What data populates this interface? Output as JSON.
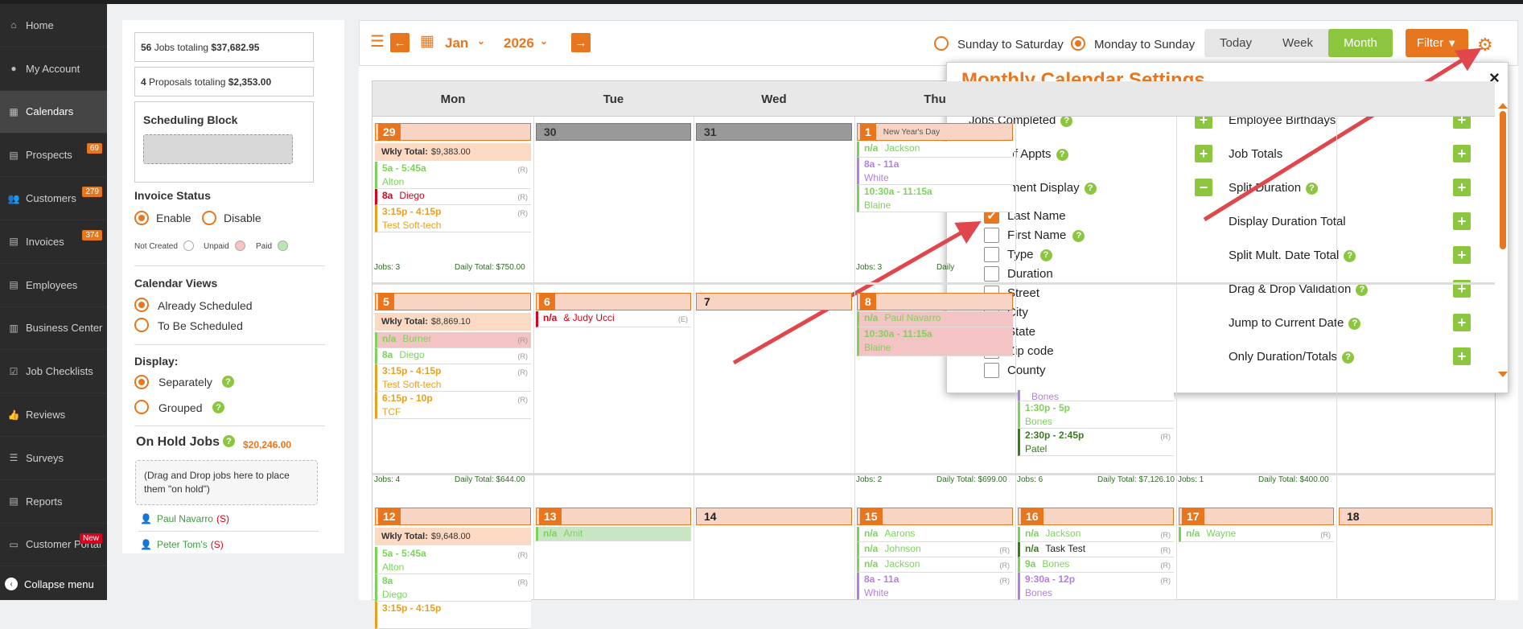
{
  "sidebar": {
    "items": [
      {
        "label": "Home",
        "icon": "home-icon",
        "glyph": "⌂"
      },
      {
        "label": "My Account",
        "icon": "user-circle-icon",
        "glyph": "●"
      },
      {
        "label": "Calendars",
        "icon": "calendar-icon",
        "glyph": "▦",
        "active": true
      },
      {
        "label": "Prospects",
        "icon": "file-icon",
        "glyph": "▤",
        "badge": "69"
      },
      {
        "label": "Customers",
        "icon": "users-icon",
        "glyph": "👥",
        "badge": "279"
      },
      {
        "label": "Invoices",
        "icon": "file-text-icon",
        "glyph": "▤",
        "badge": "374"
      },
      {
        "label": "Employees",
        "icon": "id-card-icon",
        "glyph": "▤"
      },
      {
        "label": "Business Center",
        "icon": "building-icon",
        "glyph": "▥"
      },
      {
        "label": "Job Checklists",
        "icon": "checkbox-icon",
        "glyph": "☑"
      },
      {
        "label": "Reviews",
        "icon": "thumbs-up-icon",
        "glyph": "👍"
      },
      {
        "label": "Surveys",
        "icon": "list-icon",
        "glyph": "☰"
      },
      {
        "label": "Reports",
        "icon": "report-icon",
        "glyph": "▤"
      },
      {
        "label": "Customer Portal",
        "icon": "laptop-icon",
        "glyph": "▭",
        "badge": "New"
      }
    ],
    "collapse_label": "Collapse menu"
  },
  "left_panel": {
    "jobs_count": "56",
    "jobs_text": " Jobs totaling ",
    "jobs_total": "$37,682.95",
    "proposals_count": "4",
    "proposals_text": " Proposals totaling ",
    "proposals_total": "$2,353.00",
    "scheduling_block_title": "Scheduling Block",
    "invoice_status_title": "Invoice Status",
    "enable_label": "Enable",
    "disable_label": "Disable",
    "not_created_label": "Not Created",
    "unpaid_label": "Unpaid",
    "paid_label": "Paid",
    "calendar_views_title": "Calendar Views",
    "already_scheduled_label": "Already Scheduled",
    "to_be_scheduled_label": "To Be Scheduled",
    "display_title": "Display:",
    "separately_label": "Separately",
    "grouped_label": "Grouped",
    "on_hold_title": "On Hold Jobs",
    "on_hold_total": "$20,246.00",
    "on_hold_drop_text": "(Drag and Drop jobs here to place them \"on hold\")",
    "hold_jobs": [
      {
        "name": "Paul Navarro",
        "tag": "(S)"
      },
      {
        "name": "Peter Tom's",
        "tag": "(S)"
      }
    ]
  },
  "toolbar": {
    "month": "Jan",
    "year": "2026",
    "sunday_to_saturday_label": "Sunday to Saturday",
    "monday_to_sunday_label": "Monday to Sunday",
    "today_label": "Today",
    "week_label": "Week",
    "month_label": "Month",
    "filter_label": "Filter"
  },
  "calendar": {
    "day_headers": [
      "Mon",
      "Tue",
      "Wed",
      "Thu"
    ],
    "week1": {
      "days": [
        "29",
        "30",
        "31",
        "1"
      ],
      "holiday": "New Year's Day",
      "wkly_label": "Wkly Total:",
      "wkly_total": "$9,383.00",
      "mon_appts": [
        {
          "time": "5a - 5:45a",
          "name": "Alton",
          "tag": "(R)"
        },
        {
          "time": "8a",
          "name": "Diego",
          "tag": "(R)"
        },
        {
          "time": "3:15p - 4:15p",
          "name": "Test Soft-tech",
          "tag": "(R)"
        }
      ],
      "thu_appts": [
        {
          "time": "n/a",
          "name": "Jackson"
        },
        {
          "time": "8a - 11a",
          "name": "White"
        },
        {
          "time": "10:30a - 11:15a",
          "name": "Blaine"
        }
      ],
      "mon_jobs": "Jobs: 3",
      "mon_daily": "Daily Total: $750.00",
      "thu_jobs": "Jobs: 3",
      "thu_daily": "Daily"
    },
    "week2": {
      "days": [
        "5",
        "6",
        "7",
        "8"
      ],
      "wkly_label": "Wkly Total:",
      "wkly_total": "$8,869.10",
      "mon_appts": [
        {
          "time": "n/a",
          "name": "Burner",
          "tag": "(R)"
        },
        {
          "time": "8a",
          "name": "Diego",
          "tag": "(R)"
        },
        {
          "time": "3:15p - 4:15p",
          "name": "Test Soft-tech",
          "tag": "(R)"
        },
        {
          "time": "6:15p - 10p",
          "name": "TCF",
          "tag": "(R)"
        }
      ],
      "tue_appts": [
        {
          "time": "n/a",
          "name": "& Judy Ucci",
          "tag": "(E)"
        }
      ],
      "thu_appts": [
        {
          "time": "n/a",
          "name": "Paul Navarro"
        },
        {
          "time": "10:30a - 11:15a",
          "name": "Blaine"
        }
      ],
      "fri_appts": [
        {
          "time": "",
          "name": "Bones"
        },
        {
          "time": "1:30p - 5p",
          "name": "Bones"
        },
        {
          "time": "2:30p - 2:45p",
          "name": "Patel",
          "tag": "(R)"
        }
      ],
      "footers": [
        {
          "jobs": "Jobs: 4",
          "daily": "Daily Total: $644.00"
        },
        {
          "jobs": "Jobs: 2",
          "daily": "Daily Total: $699.00"
        },
        {
          "jobs": "Jobs: 6",
          "daily": "Daily Total: $7,126.10"
        },
        {
          "jobs": "Jobs: 1",
          "daily": "Daily Total: $400.00"
        }
      ]
    },
    "week3": {
      "days": [
        "12",
        "13",
        "14",
        "15",
        "16",
        "17",
        "18"
      ],
      "wkly_label": "Wkly Total:",
      "wkly_total": "$9,648.00",
      "mon_appts": [
        {
          "time": "5a - 5:45a",
          "name": "Alton",
          "tag": "(R)"
        },
        {
          "time": "8a",
          "name": "Diego",
          "tag": "(R)"
        },
        {
          "time": "3:15p - 4:15p",
          "name": "",
          "tag": ""
        }
      ],
      "tue_appts": [
        {
          "time": "n/a",
          "name": "Amit"
        }
      ],
      "thu_appts": [
        {
          "time": "n/a",
          "name": "Aarons"
        },
        {
          "time": "n/a",
          "name": "Johnson",
          "tag": "(R)"
        },
        {
          "time": "n/a",
          "name": "Jackson",
          "tag": "(R)"
        },
        {
          "time": "8a - 11a",
          "name": "White",
          "tag": "(R)"
        }
      ],
      "fri_appts": [
        {
          "time": "n/a",
          "name": "Jackson",
          "tag": "(R)"
        },
        {
          "time": "n/a",
          "name": "Task Test",
          "tag": "(R)"
        },
        {
          "time": "9a",
          "name": "Bones",
          "tag": "(R)"
        },
        {
          "time": "9:30a - 12p",
          "name": "Bones",
          "tag": "(R)"
        }
      ],
      "sat_appts": [
        {
          "time": "n/a",
          "name": "Wayne",
          "tag": "(R)"
        }
      ]
    }
  },
  "settings": {
    "title": "Monthly Calendar Settings",
    "close": "×",
    "left_items": [
      {
        "label": "Jobs Completed",
        "help": true,
        "toggle": "+"
      },
      {
        "label": "Limit # of Appts",
        "help": true,
        "toggle": "+"
      },
      {
        "label": "Appointment Display",
        "help": true,
        "toggle": "−"
      }
    ],
    "checkbox_items": [
      {
        "label": "Last Name",
        "checked": true
      },
      {
        "label": "First Name",
        "checked": false,
        "help": true
      },
      {
        "label": "Type",
        "checked": false,
        "help": true
      },
      {
        "label": "Duration",
        "checked": false
      },
      {
        "label": "Street",
        "checked": false
      },
      {
        "label": "City",
        "checked": false
      },
      {
        "label": "State",
        "checked": false
      },
      {
        "label": "Zip code",
        "checked": false
      },
      {
        "label": "County",
        "checked": false
      }
    ],
    "right_items": [
      {
        "label": "Employee Birthdays",
        "help": false
      },
      {
        "label": "Job Totals",
        "help": false
      },
      {
        "label": "Split Duration",
        "help": true
      },
      {
        "label": "Display Duration Total",
        "help": false
      },
      {
        "label": "Split Mult. Date Total",
        "help": true
      },
      {
        "label": "Drag & Drop Validation",
        "help": true
      },
      {
        "label": "Jump to Current Date",
        "help": true
      },
      {
        "label": "Only Duration/Totals",
        "help": true
      }
    ],
    "toggle_plus": "+"
  },
  "colors": {
    "accent": "#e8761f",
    "green": "#8cc63f",
    "annotation_arrow": "#e0474c"
  }
}
